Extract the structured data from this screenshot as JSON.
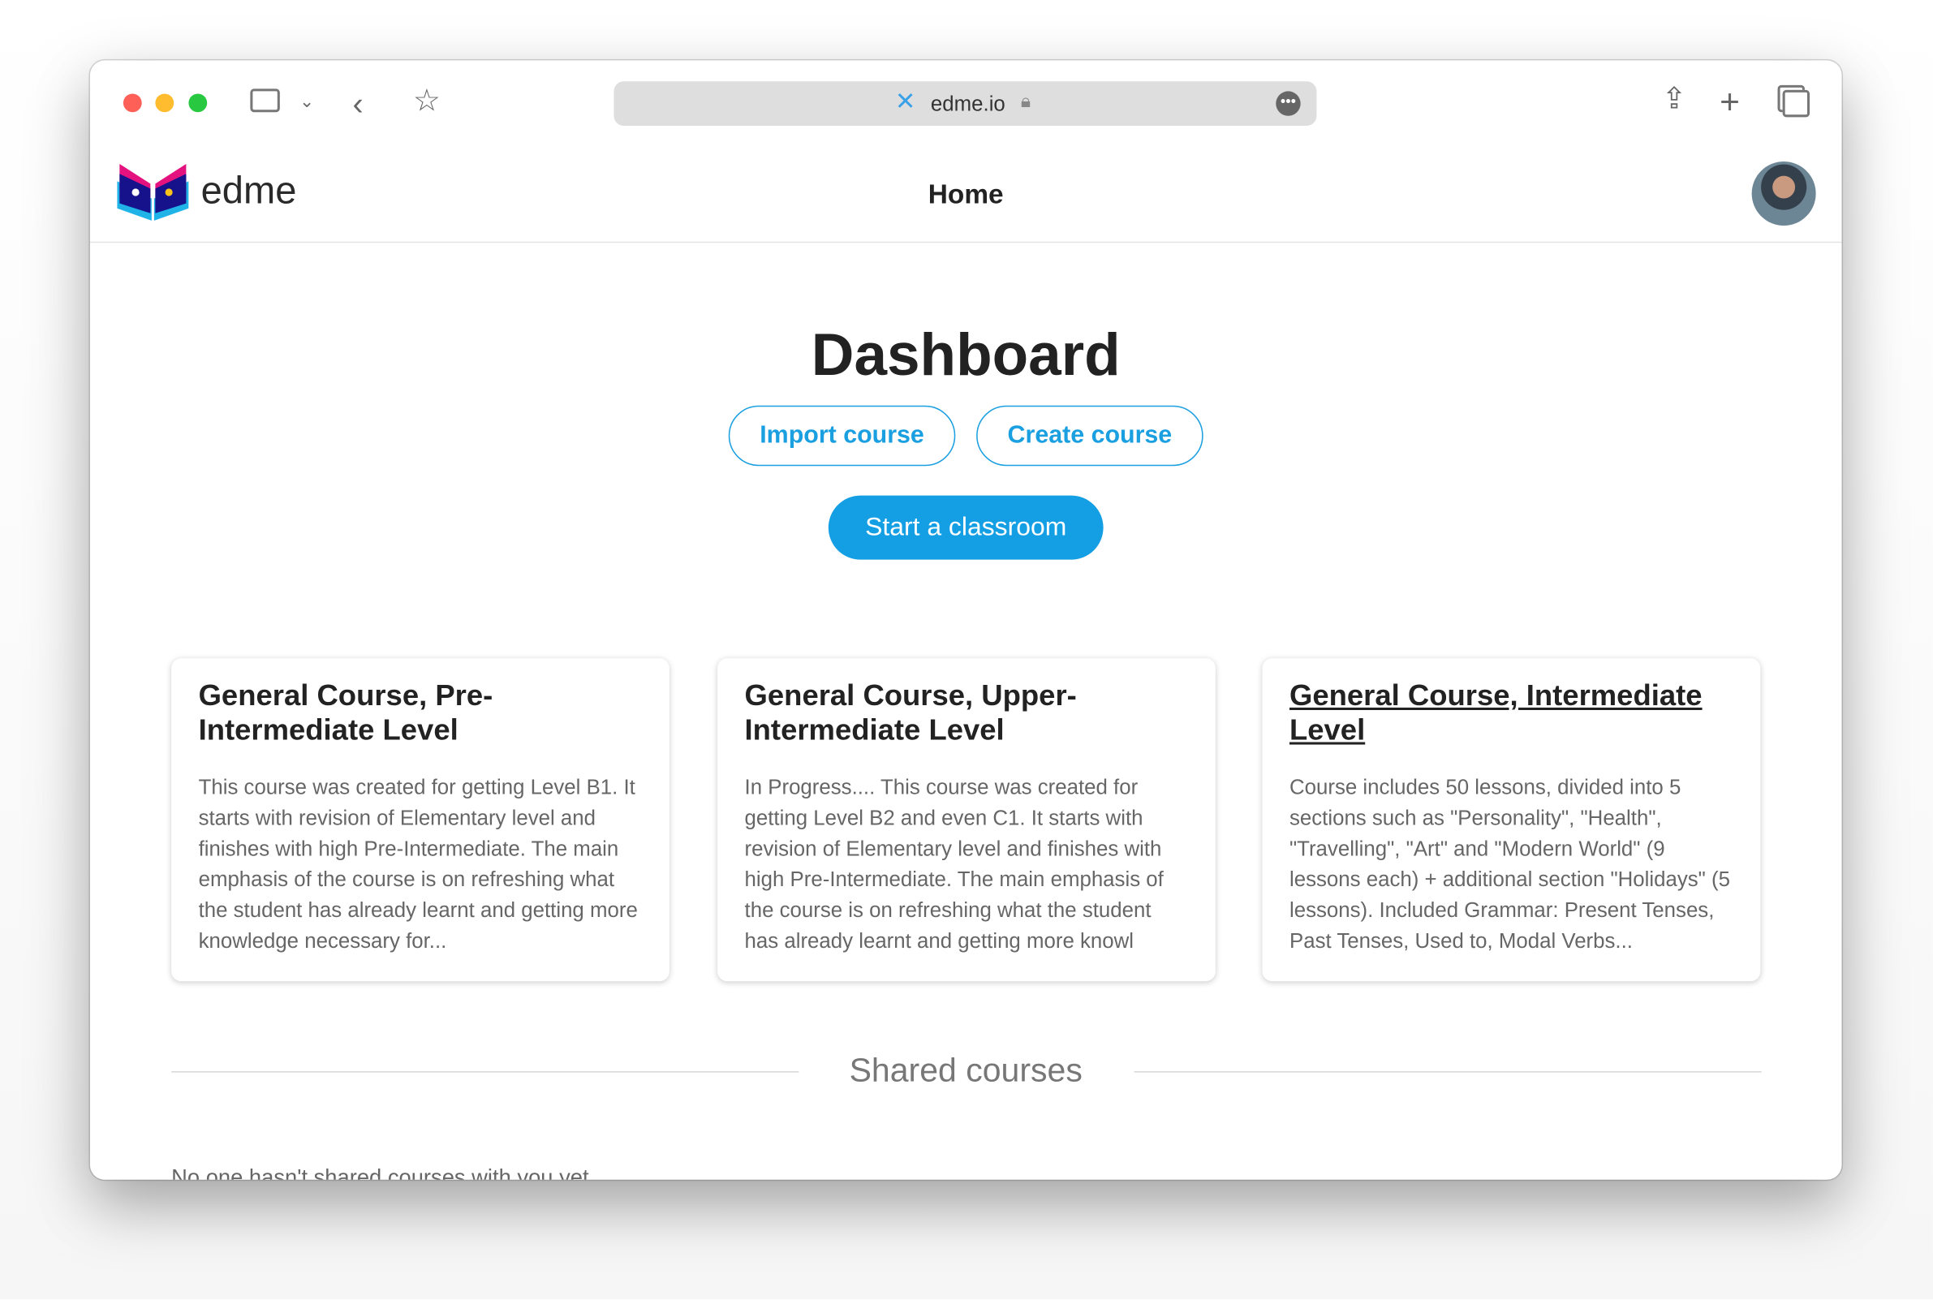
{
  "browser": {
    "url": "edme.io",
    "icons": [
      "sidebar-icon",
      "chevron-down-icon",
      "back-icon",
      "star-icon",
      "lock-icon",
      "more-icon",
      "share-icon",
      "plus-icon",
      "tabs-icon"
    ],
    "traffic_lights": [
      "#fe5f57",
      "#febc2e",
      "#28c840"
    ]
  },
  "header": {
    "logo_text": "edme",
    "nav_title": "Home"
  },
  "main": {
    "title": "Dashboard",
    "import_label": "Import course",
    "create_label": "Create course",
    "classroom_label": "Start a classroom",
    "accent": "#1a9fe0",
    "courses": [
      {
        "title": "General Course, Pre-Intermediate Level",
        "description": "This course was created for getting Level B1. It starts with revision of Elementary level and finishes with high Pre-Intermediate. The main emphasis of the course is on refreshing what the student has already learnt and getting more knowledge necessary for..."
      },
      {
        "title": "General Course, Upper-Intermediate Level",
        "description": "In Progress.... This course was created for getting Level B2 and even C1. It starts with revision of Elementary level and finishes with high Pre-Intermediate. The main emphasis of the course is on refreshing what the student has already learnt and getting more knowl"
      },
      {
        "title": "General Course, Intermediate Level",
        "description": "Course includes 50 lessons, divided into 5 sections such as \"Personality\", \"Health\", \"Travelling\", \"Art\" and \"Modern World\" (9 lessons each) + additional section \"Holidays\" (5 lessons). Included Grammar: Present Tenses, Past Tenses, Used to, Modal Verbs..."
      }
    ],
    "shared_heading": "Shared courses",
    "shared_empty": "No one hasn't shared courses with you yet"
  }
}
